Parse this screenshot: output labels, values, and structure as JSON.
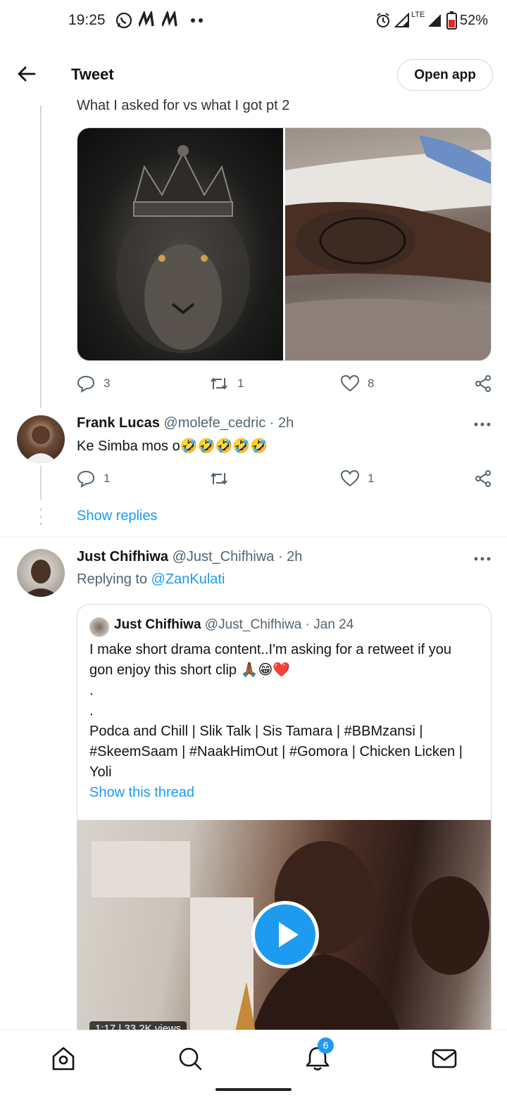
{
  "status_bar": {
    "time": "19:25",
    "battery_percent": "52%",
    "network": "LTE"
  },
  "header": {
    "title": "Tweet",
    "open_app_label": "Open app"
  },
  "main_tweet": {
    "text_partial": "What I asked for vs what I got pt 2",
    "replies": "3",
    "retweets": "1",
    "likes": "8"
  },
  "reply_1": {
    "name": "Frank Lucas",
    "handle": "@molefe_cedric",
    "time": "· 2h",
    "text": "Ke Simba mos o🤣🤣🤣🤣🤣",
    "replies": "1",
    "retweets": "",
    "likes": "1",
    "show_replies": "Show replies"
  },
  "reply_2": {
    "name": "Just Chifhiwa",
    "handle": "@Just_Chifhiwa",
    "time": "· 2h",
    "replying_prefix": "Replying to",
    "replying_to": "@ZanKulati"
  },
  "quoted": {
    "name": "Just Chifhiwa",
    "handle": "@Just_Chifhiwa",
    "date": "· Jan 24",
    "line1": "I make short drama content..I'm asking for a retweet if you",
    "line2": "gon enjoy this short clip 🙏🏾😁❤️",
    "dot1": ".",
    "dot2": ".",
    "line3": "Podca and Chill | Slik Talk | Sis Tamara | #BBMzansi |",
    "line4": "#SkeemSaam | #NaakHimOut | #Gomora | Chicken Licken |",
    "line5": "Yoli",
    "show_thread": "Show this thread",
    "video_meta": "1:17 | 33.2K views"
  },
  "bottom_nav": {
    "notification_count": "6"
  },
  "colors": {
    "accent": "#1d9bf0",
    "text": "#0f1419",
    "muted": "#536471",
    "border": "#cfd9de"
  }
}
